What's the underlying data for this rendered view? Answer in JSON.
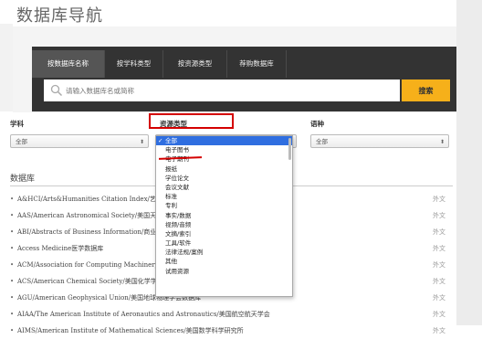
{
  "page_title": "数据库导航",
  "tabs": [
    {
      "label": "按数据库名称"
    },
    {
      "label": "按学科类型"
    },
    {
      "label": "按资源类型"
    },
    {
      "label": "荐购数据库"
    }
  ],
  "search": {
    "placeholder": "请输入数据库名或简称",
    "button_label": "搜索"
  },
  "filters": {
    "subject": {
      "label": "学科",
      "value": "全部"
    },
    "resource_type": {
      "label": "资源类型",
      "options": [
        "全部",
        "电子图书",
        "电子期刊",
        "报纸",
        "学位论文",
        "会议文献",
        "标准",
        "专利",
        "事实/数据",
        "视频/音频",
        "文摘/索引",
        "工具/软件",
        "法律法规/案例",
        "其他",
        "试用资源"
      ],
      "selected": "全部"
    },
    "language": {
      "label": "语种",
      "value": "全部"
    }
  },
  "section_title": "数据库",
  "databases": [
    {
      "name": "A&HCI/Arts&Humanities Citation Index/艺术与人文科学引文索引 (Web of Science平台)",
      "lang": "外文"
    },
    {
      "name": "AAS/American Astronomical Society/美国天文学会",
      "lang": "外文"
    },
    {
      "name": "ABI/Abstracts of Business Information/商业信息数据库",
      "lang": "外文"
    },
    {
      "name": "Access Medicine医学数据库",
      "lang": "外文"
    },
    {
      "name": "ACM/Association for Computing Machinery/美国计算机学会",
      "lang": "外文"
    },
    {
      "name": "ACS/American Chemical Society/美国化学学会",
      "lang": "外文"
    },
    {
      "name": "AGU/American Geophysical Union/美国地球物理学会数据库",
      "lang": "外文"
    },
    {
      "name": "AIAA/The American Institute of Aeronautics and Astronautics/美国航空航天学会",
      "lang": "外文"
    },
    {
      "name": "AIMS/American Institute of Mathematical Sciences/美国数学科学研究所",
      "lang": "外文"
    }
  ],
  "colors": {
    "accent": "#f6b01a",
    "tab_bar": "#333333",
    "highlight": "#d40000",
    "selected_option": "#2f6ee0"
  }
}
